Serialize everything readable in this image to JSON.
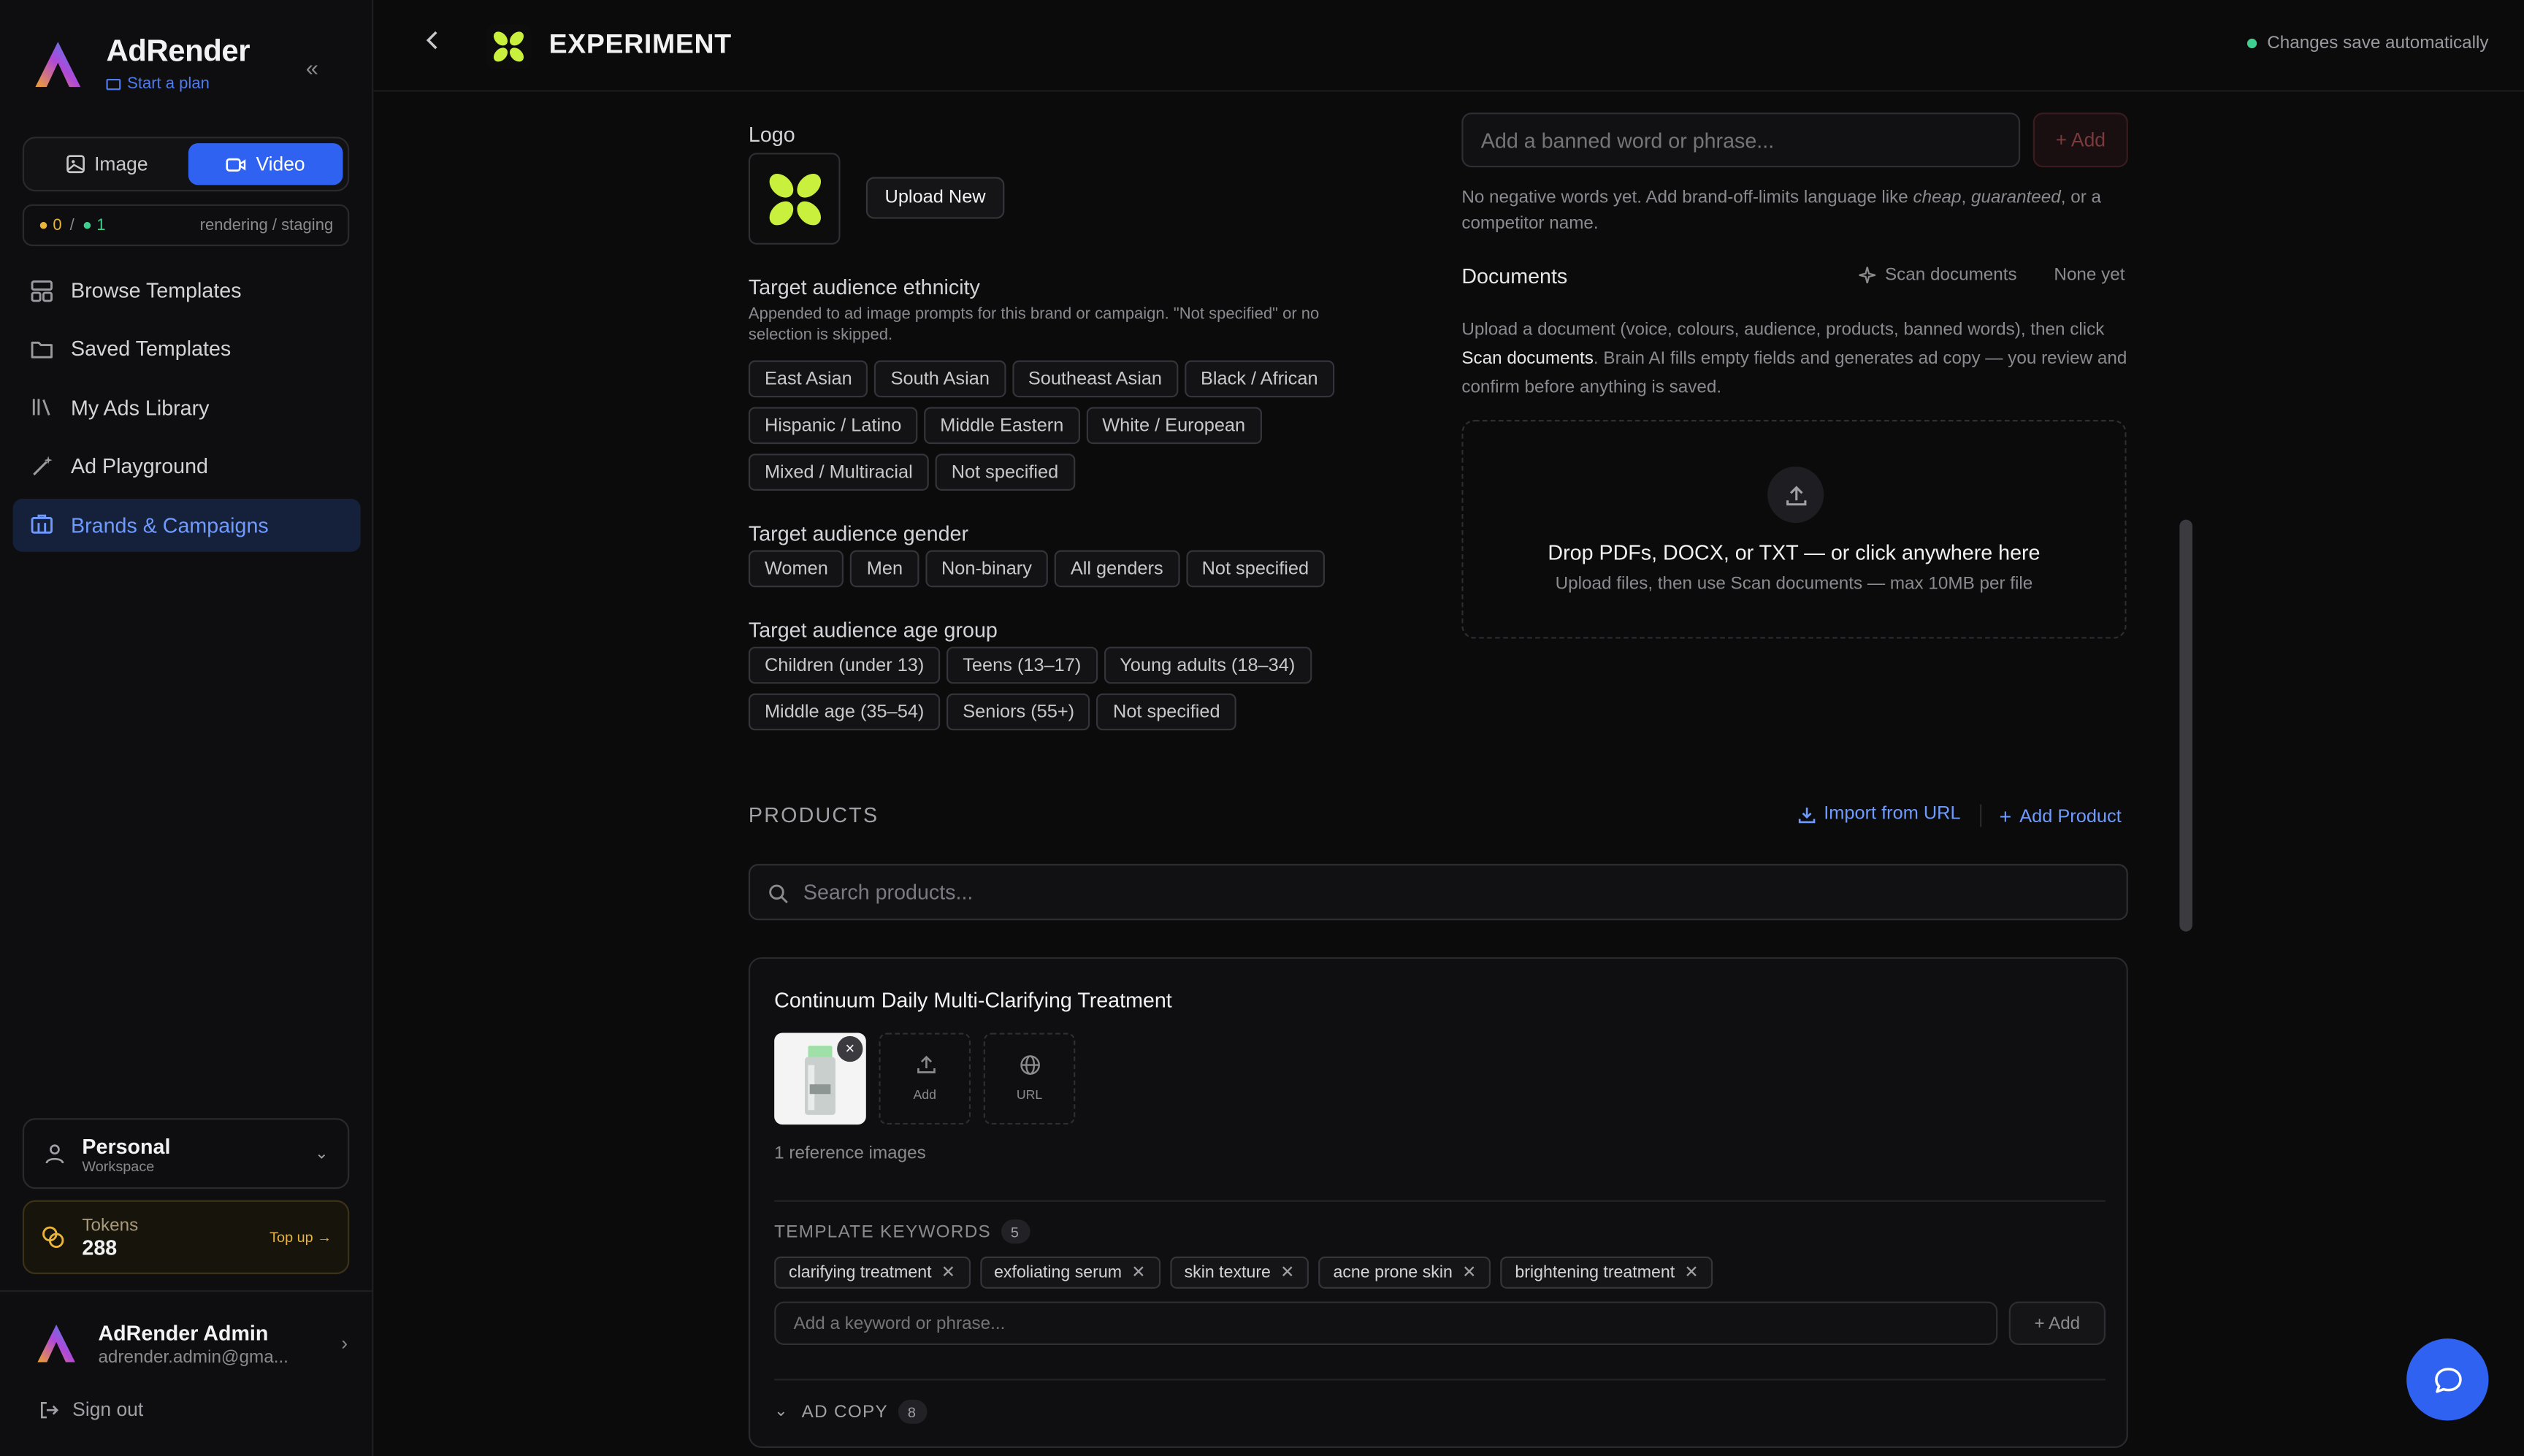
{
  "sidebar": {
    "brand_name": "AdRender",
    "brand_sub": "Start a plan",
    "toggle": {
      "image": "Image",
      "video": "Video"
    },
    "status": {
      "yellow": "● 0",
      "sep": "/",
      "green": "● 1",
      "label": "rendering / staging"
    },
    "nav": [
      {
        "label": "Browse Templates",
        "icon": "layout-icon"
      },
      {
        "label": "Saved Templates",
        "icon": "folder-icon"
      },
      {
        "label": "My Ads Library",
        "icon": "library-icon"
      },
      {
        "label": "Ad Playground",
        "icon": "wand-icon"
      },
      {
        "label": "Brands & Campaigns",
        "icon": "building-icon"
      }
    ],
    "workspace": {
      "name": "Personal",
      "sub": "Workspace"
    },
    "tokens": {
      "label": "Tokens",
      "value": "288",
      "topup": "Top up →"
    },
    "user": {
      "name": "AdRender Admin",
      "email": "adrender.admin@gma..."
    },
    "signout": "Sign out"
  },
  "header": {
    "title": "EXPERIMENT",
    "autosave": "Changes save automatically"
  },
  "brand": {
    "logo_label": "Logo",
    "upload_label": "Upload New",
    "ethnicity": {
      "label": "Target audience ethnicity",
      "help": "Appended to ad image prompts for this brand or campaign. \"Not specified\" or no selection is skipped.",
      "row1": [
        "East Asian",
        "South Asian",
        "Southeast Asian",
        "Black / African"
      ],
      "row2": [
        "Hispanic / Latino",
        "Middle Eastern",
        "White / European"
      ],
      "row3": [
        "Mixed / Multiracial",
        "Not specified"
      ]
    },
    "gender": {
      "label": "Target audience gender",
      "options": [
        "Women",
        "Men",
        "Non-binary",
        "All genders",
        "Not specified"
      ]
    },
    "age": {
      "label": "Target audience age group",
      "row1": [
        "Children (under 13)",
        "Teens (13–17)",
        "Young adults (18–34)"
      ],
      "row2": [
        "Middle age (35–54)",
        "Seniors (55+)",
        "Not specified"
      ]
    }
  },
  "banned": {
    "placeholder": "Add a banned word or phrase...",
    "add": "+ Add",
    "empty_pre": "No negative words yet. Add brand-off-limits language like ",
    "ex1": "cheap",
    "comma": ", ",
    "ex2": "guaranteed",
    "empty_post": ", or a competitor name."
  },
  "documents": {
    "title": "Documents",
    "scan": "Scan documents",
    "none": "None yet",
    "desc_pre": "Upload a document (voice, colours, audience, products, banned words), then click ",
    "desc_bold": "Scan documents",
    "desc_post": ". Brain AI fills empty fields and generates ad copy — you review and confirm before anything is saved.",
    "drop_title": "Drop PDFs, DOCX, or TXT — or click anywhere here",
    "drop_sub": "Upload files, then use Scan documents — max 10MB per file"
  },
  "products": {
    "title": "PRODUCTS",
    "import": "Import from URL",
    "add": "Add Product",
    "search_placeholder": "Search products...",
    "item": {
      "name": "Continuum Daily Multi-Clarifying Treatment",
      "add_label": "Add",
      "url_label": "URL",
      "ref_count": "1 reference images",
      "keywords_title": "TEMPLATE KEYWORDS",
      "keywords_count": "5",
      "keywords": [
        "clarifying treatment",
        "exfoliating serum",
        "skin texture",
        "acne prone skin",
        "brightening treatment"
      ],
      "keyword_placeholder": "Add a keyword or phrase...",
      "keyword_add": "+ Add",
      "adcopy_title": "AD COPY",
      "adcopy_count": "8"
    }
  },
  "colors": {
    "accent": "#2f62f0",
    "link": "#6f9bff",
    "lime": "#c8f03c"
  }
}
